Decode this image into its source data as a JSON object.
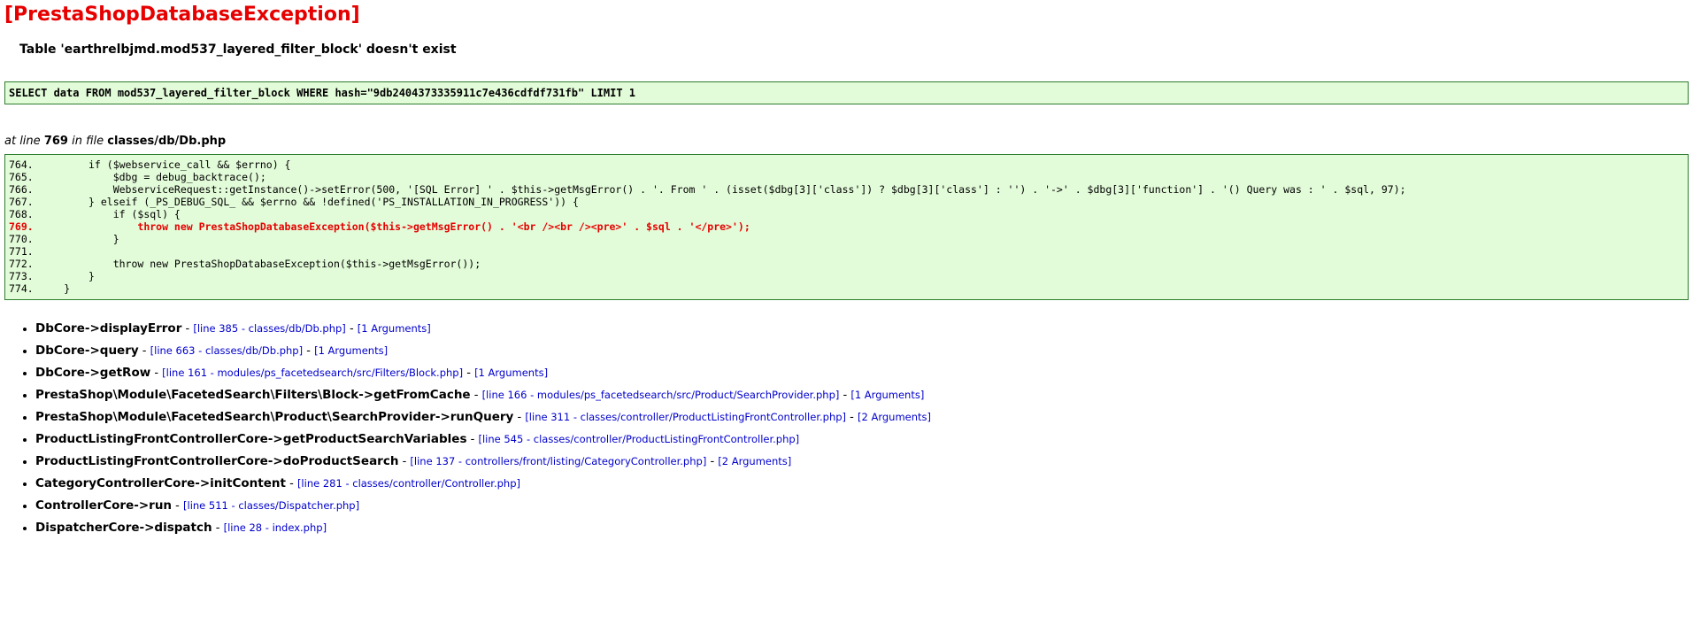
{
  "error": {
    "title": "[PrestaShopDatabaseException]",
    "message": "Table 'earthrelbjmd.mod537_layered_filter_block' doesn't exist",
    "sql": "SELECT data FROM mod537_layered_filter_block WHERE hash=\"9db2404373335911c7e436cdfdf731fb\" LIMIT 1"
  },
  "location": {
    "prefix": "at line",
    "line": "769",
    "middle": "in file",
    "file": "classes/db/Db.php"
  },
  "code_lines": [
    {
      "num": "764.",
      "text": "        if ($webservice_call && $errno) {",
      "error": false
    },
    {
      "num": "765.",
      "text": "            $dbg = debug_backtrace();",
      "error": false
    },
    {
      "num": "766.",
      "text": "            WebserviceRequest::getInstance()->setError(500, '[SQL Error] ' . $this->getMsgError() . '. From ' . (isset($dbg[3]['class']) ? $dbg[3]['class'] : '') . '->' . $dbg[3]['function'] . '() Query was : ' . $sql, 97);",
      "error": false
    },
    {
      "num": "767.",
      "text": "        } elseif (_PS_DEBUG_SQL_ && $errno && !defined('PS_INSTALLATION_IN_PROGRESS')) {",
      "error": false
    },
    {
      "num": "768.",
      "text": "            if ($sql) {",
      "error": false
    },
    {
      "num": "769.",
      "text": "                throw new PrestaShopDatabaseException($this->getMsgError() . '<br /><br /><pre>' . $sql . '</pre>');",
      "error": true
    },
    {
      "num": "770.",
      "text": "            }",
      "error": false
    },
    {
      "num": "771.",
      "text": "",
      "error": false
    },
    {
      "num": "772.",
      "text": "            throw new PrestaShopDatabaseException($this->getMsgError());",
      "error": false
    },
    {
      "num": "773.",
      "text": "        }",
      "error": false
    },
    {
      "num": "774.",
      "text": "    }",
      "error": false
    }
  ],
  "trace": [
    {
      "fn": "DbCore->displayError",
      "link": "[line 385 - classes/db/Db.php]",
      "args": "[1 Arguments]"
    },
    {
      "fn": "DbCore->query",
      "link": "[line 663 - classes/db/Db.php]",
      "args": "[1 Arguments]"
    },
    {
      "fn": "DbCore->getRow",
      "link": "[line 161 - modules/ps_facetedsearch/src/Filters/Block.php]",
      "args": "[1 Arguments]"
    },
    {
      "fn": "PrestaShop\\Module\\FacetedSearch\\Filters\\Block->getFromCache",
      "link": "[line 166 - modules/ps_facetedsearch/src/Product/SearchProvider.php]",
      "args": "[1 Arguments]"
    },
    {
      "fn": "PrestaShop\\Module\\FacetedSearch\\Product\\SearchProvider->runQuery",
      "link": "[line 311 - classes/controller/ProductListingFrontController.php]",
      "args": "[2 Arguments]"
    },
    {
      "fn": "ProductListingFrontControllerCore->getProductSearchVariables",
      "link": "[line 545 - classes/controller/ProductListingFrontController.php]",
      "args": ""
    },
    {
      "fn": "ProductListingFrontControllerCore->doProductSearch",
      "link": "[line 137 - controllers/front/listing/CategoryController.php]",
      "args": "[2 Arguments]"
    },
    {
      "fn": "CategoryControllerCore->initContent",
      "link": "[line 281 - classes/controller/Controller.php]",
      "args": ""
    },
    {
      "fn": "ControllerCore->run",
      "link": "[line 511 - classes/Dispatcher.php]",
      "args": ""
    },
    {
      "fn": "DispatcherCore->dispatch",
      "link": "[line 28 - index.php]",
      "args": ""
    }
  ]
}
